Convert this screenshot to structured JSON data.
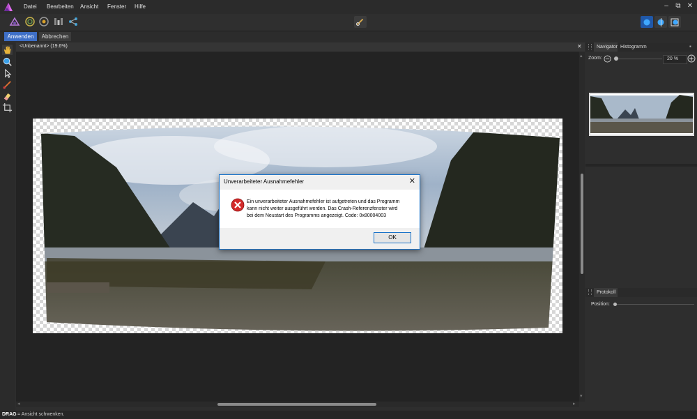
{
  "menubar": {
    "items": [
      "Datei",
      "Bearbeiten",
      "Ansicht",
      "Fenster",
      "Hilfe"
    ],
    "window_controls": [
      "–",
      "⧉",
      "✕"
    ]
  },
  "toolbar": {
    "personas": [
      "photo-persona-icon",
      "liquify-persona-icon",
      "develop-persona-icon",
      "tone-mapping-persona-icon",
      "export-persona-icon"
    ],
    "center_tool": "brush-options-icon",
    "right_buttons": [
      "view-mode-1-icon",
      "view-mode-2-icon",
      "view-mode-3-icon"
    ]
  },
  "applybar": {
    "apply_label": "Anwenden",
    "cancel_label": "Abbrechen"
  },
  "document": {
    "tab_title": "<Unbenannt> (19.6%)",
    "close_glyph": "✕"
  },
  "dialog": {
    "title": "Unverarbeiteter Ausnahmefehler",
    "close_glyph": "✕",
    "message": "Ein unverarbeiteter Ausnahmefehler ist aufgetreten und das Programm\nkann nicht weiter ausgeführt werden. Das Crash-Referenzfenster wird\nbei dem Neustart des Programms angezeigt. Code: 0x80004003",
    "ok_label": "OK"
  },
  "navigator": {
    "tabs": [
      "Navigator",
      "Histogramm"
    ],
    "zoom_label": "Zoom:",
    "zoom_value": "20 %",
    "zoom_fraction": 0.05
  },
  "history": {
    "tab": "Protokoll",
    "position_label": "Position:"
  },
  "statusbar": {
    "key": "DRAG",
    "text": "= Ansicht schwenken."
  },
  "colors": {
    "accent": "#3e6fc7",
    "dialog_border": "#1a73c9",
    "error_red": "#d32b2b"
  }
}
